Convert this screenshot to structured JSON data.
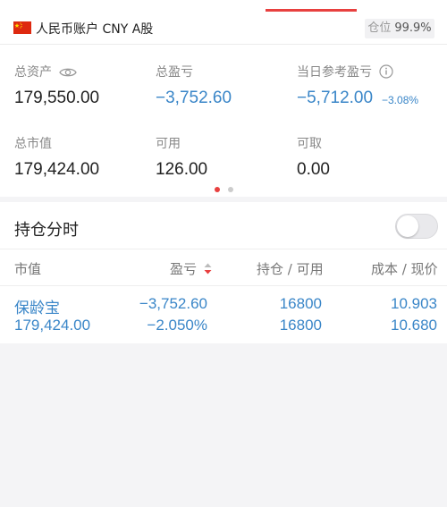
{
  "account": {
    "name": "人民币账户 CNY A股",
    "position_label": "仓位",
    "position_value": "99.9%"
  },
  "metrics": {
    "total_assets": {
      "label": "总资产",
      "value": "179,550.00"
    },
    "total_pnl": {
      "label": "总盈亏",
      "value": "−3,752.60"
    },
    "daily_pnl": {
      "label": "当日参考盈亏",
      "value": "−5,712.00",
      "pct": "−3.08%"
    },
    "market_value": {
      "label": "总市值",
      "value": "179,424.00"
    },
    "available": {
      "label": "可用",
      "value": "126.00"
    },
    "withdrawable": {
      "label": "可取",
      "value": "0.00"
    }
  },
  "pager": {
    "total": 2,
    "active": 1
  },
  "holdings": {
    "title": "持仓分时",
    "toggle_on": false,
    "columns": [
      "市值",
      "盈亏",
      "持仓 / 可用",
      "成本 / 现价"
    ],
    "rows": [
      {
        "name": "保龄宝",
        "market_value": "179,424.00",
        "pnl": "−3,752.60",
        "pnl_pct": "−2.050%",
        "holding": "16800",
        "available": "16800",
        "cost": "10.903",
        "price": "10.680"
      }
    ]
  },
  "colors": {
    "accent_red": "#e8403f",
    "loss_blue": "#3a86c8",
    "background": "#f4f4f6"
  },
  "icons": {
    "flag": "china-flag-icon",
    "eye": "eye-icon",
    "info": "info-icon",
    "sort": "sort-icon"
  }
}
